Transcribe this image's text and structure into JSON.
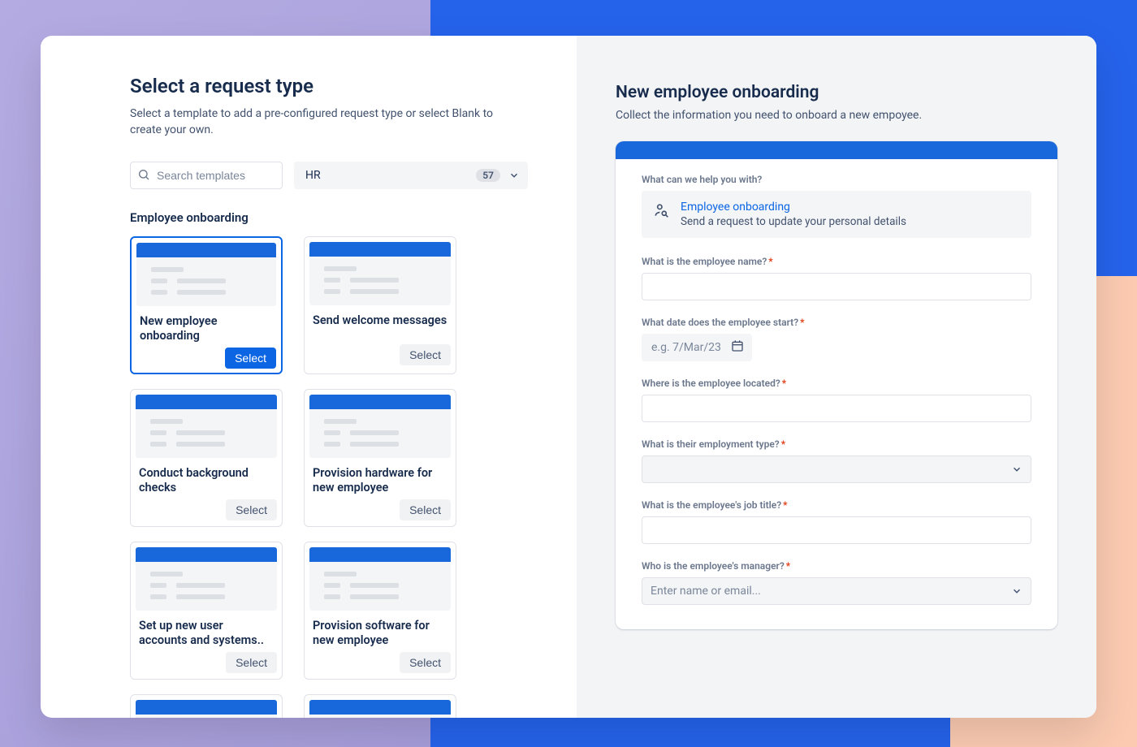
{
  "left": {
    "title": "Select a request type",
    "subtitle": "Select a template to add a pre-configured request type or select Blank to create your own.",
    "search_placeholder": "Search templates",
    "category": {
      "label": "HR",
      "count": "57"
    },
    "section_heading": "Employee onboarding",
    "select_label": "Select",
    "cards": [
      {
        "title": "New employee onboarding",
        "selected": true
      },
      {
        "title": "Send welcome messages",
        "selected": false
      },
      {
        "title": "Conduct background checks",
        "selected": false
      },
      {
        "title": "Provision hardware for new employee",
        "selected": false
      },
      {
        "title": "Set up new user accounts and systems..",
        "selected": false
      },
      {
        "title": "Provision software for new employee",
        "selected": false
      }
    ]
  },
  "right": {
    "title": "New employee onboarding",
    "subtitle": "Collect the information you need to onboard a new empoyee.",
    "help_question": "What can we help you with?",
    "help_box": {
      "title": "Employee onboarding",
      "desc": "Send a request to update your personal details"
    },
    "fields": {
      "name_label": "What is the employee name?",
      "start_label": "What date does the employee start?",
      "start_placeholder": "e.g. 7/Mar/23",
      "location_label": "Where is the employee located?",
      "type_label": "What is their employment type?",
      "jobtitle_label": "What is the employee's job title?",
      "manager_label": "Who is the employee's manager?",
      "manager_placeholder": "Enter name or email..."
    }
  }
}
